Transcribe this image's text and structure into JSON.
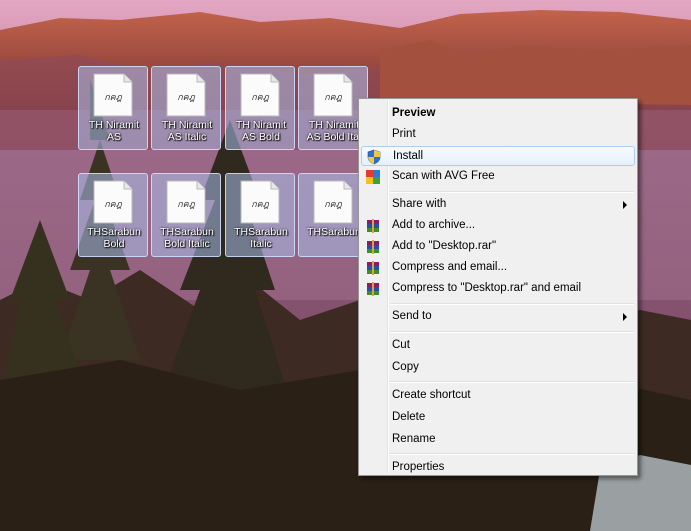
{
  "desktop": {
    "icons": [
      {
        "thumb_text": "กคฎ",
        "caption": "TH Niramit\nAS"
      },
      {
        "thumb_text": "กคฎ",
        "caption": "TH Niramit\nAS Italic"
      },
      {
        "thumb_text": "กคฎ",
        "caption": "TH Niramit\nAS Bold"
      },
      {
        "thumb_text": "กคฎ",
        "caption": "TH Niramit\nAS Bold Ital"
      },
      {
        "thumb_text": "กคฎ",
        "caption": "THSarabun\nBold"
      },
      {
        "thumb_text": "กคฎ",
        "caption": "THSarabun\nBold Italic"
      },
      {
        "thumb_text": "กคฎ",
        "caption": "THSarabun\nItalic"
      },
      {
        "thumb_text": "กคฎ",
        "caption": "THSarabun"
      }
    ]
  },
  "context_menu": {
    "preview": "Preview",
    "print": "Print",
    "install": "Install",
    "scan": "Scan with AVG Free",
    "share_with": "Share with",
    "add_to_archive": "Add to archive...",
    "add_to_rar": "Add to \"Desktop.rar\"",
    "compress_email": "Compress and email...",
    "compress_rar_email": "Compress to \"Desktop.rar\" and email",
    "send_to": "Send to",
    "cut": "Cut",
    "copy": "Copy",
    "create_shortcut": "Create shortcut",
    "delete": "Delete",
    "rename": "Rename",
    "properties": "Properties"
  },
  "icons": {
    "install": "uac-shield-icon",
    "scan": "avg-icon",
    "archive": "winrar-icon"
  },
  "colors": {
    "menu_bg": "#f0f0f0",
    "hover_border": "#aeccef",
    "tile_bg": "#aabeeb"
  }
}
